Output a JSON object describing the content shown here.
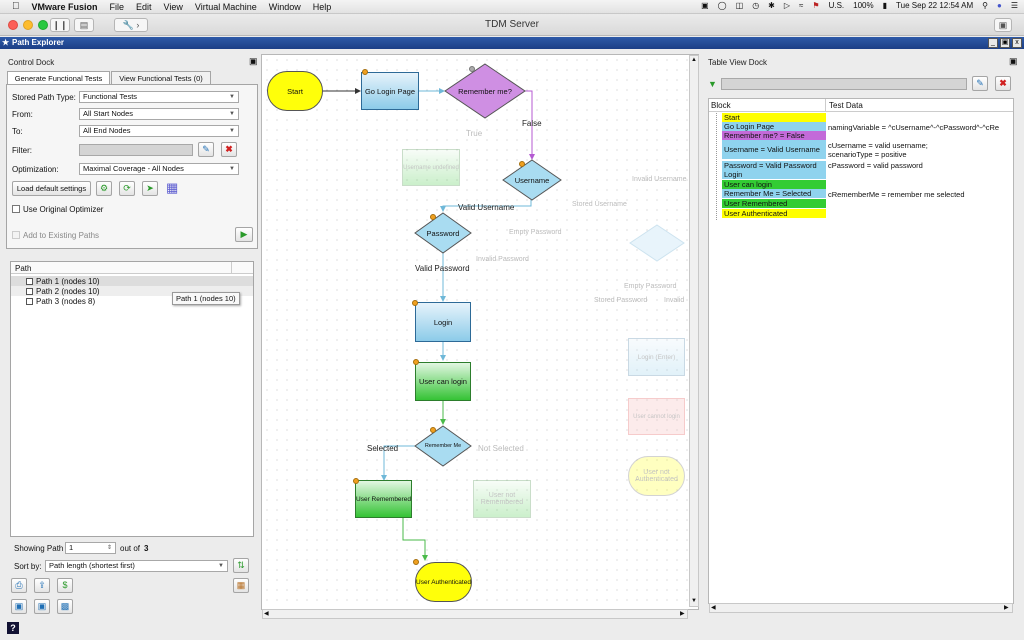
{
  "menubar": {
    "apple": "",
    "app_name": "VMware Fusion",
    "items": [
      "File",
      "Edit",
      "View",
      "Virtual Machine",
      "Window",
      "Help"
    ],
    "flag_label": "U.S.",
    "battery": "100%",
    "clock": "Tue Sep 22  12:54 AM"
  },
  "window": {
    "title": "TDM Server"
  },
  "app": {
    "title": "Path Explorer"
  },
  "control_dock": {
    "title": "Control Dock",
    "tabs": [
      "Generate Functional Tests",
      "View Functional Tests (0)"
    ],
    "stored_path_type_label": "Stored Path Type:",
    "stored_path_type_value": "Functional Tests",
    "from_label": "From:",
    "from_value": "All Start Nodes",
    "to_label": "To:",
    "to_value": "All End Nodes",
    "filter_label": "Filter:",
    "filter_value": "",
    "optimization_label": "Optimization:",
    "optimization_value": "Maximal Coverage - All Nodes",
    "load_default_label": "Load default settings",
    "use_original_label": "Use Original Optimizer",
    "add_existing_label": "Add to Existing Paths"
  },
  "paths": {
    "header": "Path",
    "items": [
      "Path 1 (nodes 10)",
      "Path 2 (nodes 10)",
      "Path 3 (nodes 8)"
    ],
    "tooltip": "Path 1 (nodes 10)",
    "showing_label": "Showing Path",
    "showing_value": "1",
    "out_of_label": "out of",
    "total": "3",
    "sort_label": "Sort by:",
    "sort_value": "Path length (shortest first)"
  },
  "flow": {
    "nodes": {
      "start": "Start",
      "go_login": "Go Login Page",
      "remember_q": "Remember me?",
      "username": "Username",
      "password": "Password",
      "login": "Login",
      "user_can_login": "User can login",
      "remember_me": "Remember Me",
      "user_remembered": "User Remembered",
      "user_authenticated": "User Authenticated"
    },
    "edges": {
      "false": "False",
      "valid_username": "Valid Username",
      "valid_password": "Valid Password",
      "selected": "Selected"
    },
    "ghost": {
      "true": "True",
      "username_undefined": "Username undefined",
      "invalid_username": "Invalid Username",
      "stored_username": "Stored Username",
      "empty_password": "Empty Password",
      "invalid_password": "Invalid Password",
      "empty_password2": "Empty Password",
      "stored_password": "Stored Password",
      "invalid2": "Invalid",
      "login_ghost": "Login (Enter)",
      "user_cannot_login": "User cannot login",
      "not_selected": "Not Selected",
      "user_not_remembered": "User not Remembered",
      "user_not_authenticated": "User not Authenticated"
    }
  },
  "table_dock": {
    "title": "Table View Dock",
    "col_block": "Block",
    "col_test_data": "Test Data",
    "rows": [
      {
        "block": "Start",
        "color": "#ffff00",
        "data": []
      },
      {
        "block": "Go Login Page",
        "color": "#8fd3ee",
        "data": [
          "namingVariable = ^cUsername^-^cPassword^-^cRe"
        ]
      },
      {
        "block": "Remember me? = False",
        "color": "#c36ad9",
        "data": []
      },
      {
        "block": "Username = Valid Username",
        "color": "#8fd3ee",
        "data": [
          "cUsername = valid username;",
          "scenarioType = positive"
        ]
      },
      {
        "block": "Password = Valid Password",
        "color": "#8fd3ee",
        "data": [
          "cPassword = valid password"
        ]
      },
      {
        "block": "Login",
        "color": "#8fd3ee",
        "data": []
      },
      {
        "block": "User can login",
        "color": "#33cc33",
        "data": []
      },
      {
        "block": "Remember Me = Selected",
        "color": "#8fd3ee",
        "data": [
          "cRememberMe = remember me selected"
        ]
      },
      {
        "block": "User Remembered",
        "color": "#33cc33",
        "data": []
      },
      {
        "block": "User Authenticated",
        "color": "#ffff00",
        "data": []
      }
    ]
  },
  "colors": {
    "titlebar_blue": "#1c3f86",
    "node_blue": "#8ccbe9",
    "node_green": "#35c335",
    "node_yellow": "#ffff0a",
    "node_purple": "#c36ad9"
  }
}
